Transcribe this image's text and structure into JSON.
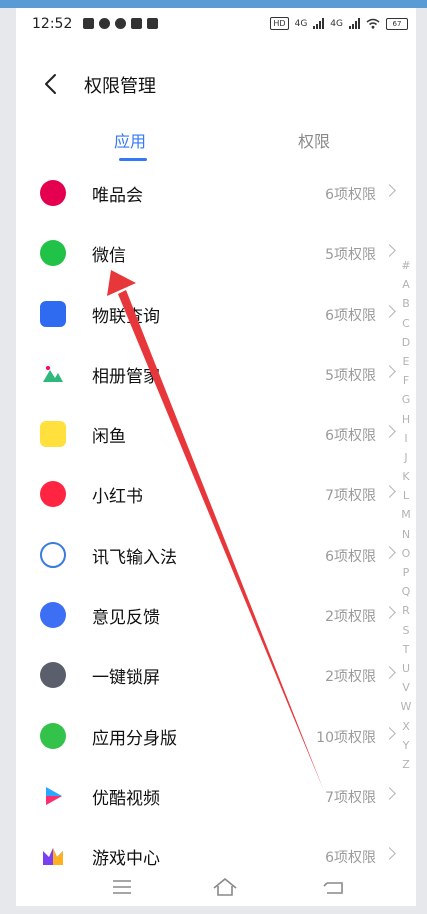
{
  "status_bar": {
    "time": "12:52",
    "signal1": "4G",
    "signal2": "4G",
    "battery": "67"
  },
  "header": {
    "title": "权限管理"
  },
  "tabs": [
    {
      "label": "应用",
      "active": true
    },
    {
      "label": "权限",
      "active": false
    }
  ],
  "apps": [
    {
      "name": "唯品会",
      "permissions": "6项权限",
      "icon": "vipshop-icon",
      "color": "#e5004f"
    },
    {
      "name": "微信",
      "permissions": "5项权限",
      "icon": "wechat-icon",
      "color": "#20c247"
    },
    {
      "name": "物联查询",
      "permissions": "6项权限",
      "icon": "iot-query-icon",
      "color": "#2e6bf0"
    },
    {
      "name": "相册管家",
      "permissions": "5项权限",
      "icon": "album-icon",
      "color": "#2eb87b"
    },
    {
      "name": "闲鱼",
      "permissions": "6项权限",
      "icon": "xianyu-icon",
      "color": "#ffe03d"
    },
    {
      "name": "小红书",
      "permissions": "7项权限",
      "icon": "xiaohongshu-icon",
      "color": "#ff2442"
    },
    {
      "name": "讯飞输入法",
      "permissions": "6项权限",
      "icon": "iflytek-icon",
      "color": "#3a7be0"
    },
    {
      "name": "意见反馈",
      "permissions": "2项权限",
      "icon": "feedback-icon",
      "color": "#3d6ff5"
    },
    {
      "name": "一键锁屏",
      "permissions": "2项权限",
      "icon": "lockscreen-icon",
      "color": "#5a5f6b"
    },
    {
      "name": "应用分身版",
      "permissions": "10项权限",
      "icon": "app-clone-icon",
      "color": "#33c24a"
    },
    {
      "name": "优酷视频",
      "permissions": "7项权限",
      "icon": "youku-icon",
      "color": "#2aa7ff"
    },
    {
      "name": "游戏中心",
      "permissions": "6项权限",
      "icon": "game-center-icon",
      "color": "#7b3ff2"
    }
  ],
  "index_letters": [
    "#",
    "A",
    "B",
    "C",
    "D",
    "E",
    "F",
    "G",
    "H",
    "I",
    "J",
    "K",
    "L",
    "M",
    "N",
    "O",
    "P",
    "Q",
    "R",
    "S",
    "T",
    "U",
    "V",
    "W",
    "X",
    "Y",
    "Z"
  ],
  "annotation": {
    "color": "#e8373b"
  }
}
